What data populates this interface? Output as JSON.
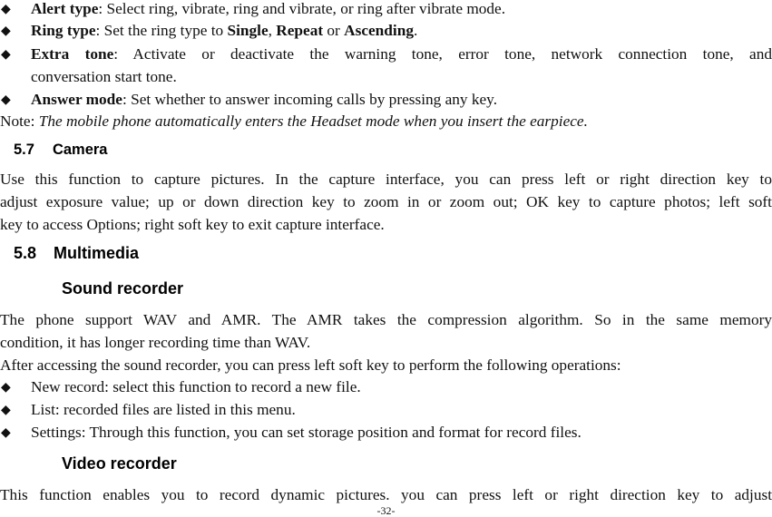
{
  "bullets_top": [
    {
      "term": "Alert type",
      "text": ": Select ring, vibrate, ring and vibrate, or ring after vibrate mode."
    },
    {
      "term": "Ring type",
      "text_a": ": Set the ring type to ",
      "opt1": "Single",
      "sep1": ", ",
      "opt2": "Repeat",
      "sep2": " or ",
      "opt3": "Ascending",
      "end": "."
    },
    {
      "term": "Extra tone",
      "text_line1": ": Activate or deactivate the warning tone, error tone, network connection tone, and",
      "text_line2": "conversation start tone."
    },
    {
      "term": "Answer mode",
      "text": ": Set whether to answer incoming calls by pressing any key."
    }
  ],
  "note": {
    "label": "Note: ",
    "text": "The mobile phone automatically enters the Headset mode when you insert the earpiece."
  },
  "section_57": {
    "number": "5.7",
    "title": "Camera"
  },
  "camera_para": [
    "Use this function to capture pictures. In the capture interface, you can press left or right direction key to",
    "adjust exposure value; up or down direction key to zoom in or zoom out; OK key to capture photos; left soft",
    "key to access Options; right soft key to exit capture interface."
  ],
  "section_58": {
    "number": "5.8",
    "title": "Multimedia"
  },
  "sound_recorder": {
    "title": "Sound recorder",
    "para": [
      "The phone support WAV and AMR. The AMR takes the compression algorithm. So in the same memory",
      "condition, it has longer recording time than WAV."
    ],
    "intro": "After accessing the sound recorder, you can press left soft key to perform the following operations:",
    "bullets": [
      "New record: select this function to record a new file.",
      "List: recorded files are listed in this menu.",
      "Settings: Through this function, you can set storage position and format for record files."
    ]
  },
  "video_recorder": {
    "title": "Video recorder",
    "para": [
      "This function enables you to record dynamic pictures. you can press left or right direction key to adjust"
    ]
  },
  "bullet_glyph": "◆",
  "page_number": "-32-"
}
